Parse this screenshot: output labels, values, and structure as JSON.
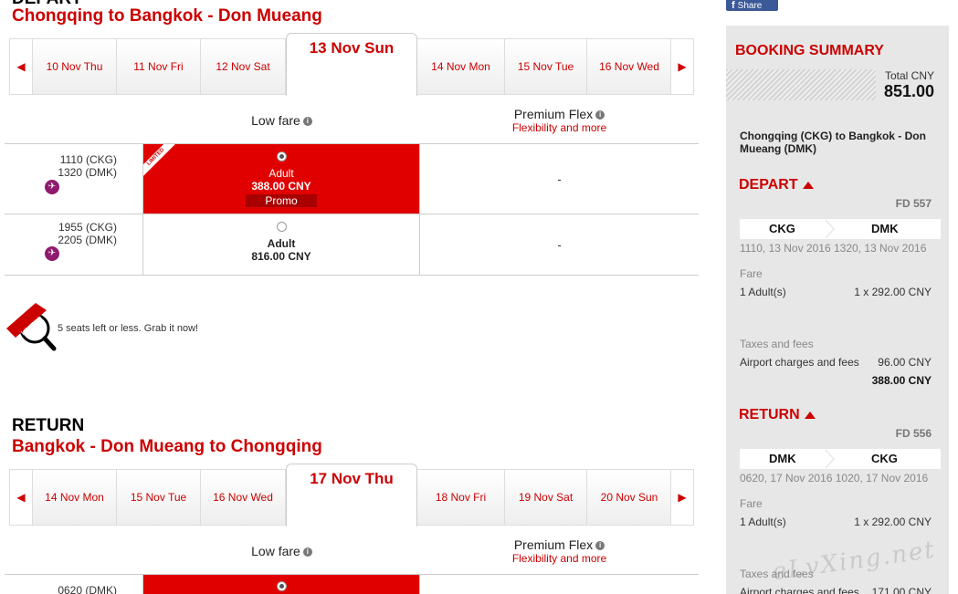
{
  "depart": {
    "label": "DEPART",
    "route": "Chongqing  to  Bangkok - Don Mueang",
    "days": [
      "10 Nov Thu",
      "11 Nov Fri",
      "12 Nov Sat",
      "13 Nov Sun",
      "14 Nov Mon",
      "15 Nov Tue",
      "16 Nov Wed"
    ],
    "fare_headers": {
      "low": "Low fare",
      "flex": "Premium Flex",
      "flex_sub": "Flexibility and more"
    },
    "flights": [
      {
        "dep": "1110  (CKG)",
        "arr": "1320  (DMK)",
        "pax": "Adult",
        "price": "388.00 CNY",
        "promo": "Promo",
        "ribbon": "LIMITED",
        "flex": "-"
      },
      {
        "dep": "1955  (CKG)",
        "arr": "2205  (DMK)",
        "pax": "Adult",
        "price": "816.00 CNY",
        "flex": "-"
      }
    ]
  },
  "limited": {
    "badge": "LIMITED",
    "note": "5 seats left or less. Grab it now!"
  },
  "return": {
    "label": "RETURN",
    "route": "Bangkok - Don Mueang  to  Chongqing",
    "days": [
      "14 Nov Mon",
      "15 Nov Tue",
      "16 Nov Wed",
      "17 Nov Thu",
      "18 Nov Fri",
      "19 Nov Sat",
      "20 Nov Sun"
    ],
    "fare_headers": {
      "low": "Low fare",
      "flex": "Premium Flex",
      "flex_sub": "Flexibility and more"
    },
    "flights": [
      {
        "dep": "0620  (DMK)"
      }
    ]
  },
  "share": {
    "icon": "f",
    "label": "Share"
  },
  "summary": {
    "title": "BOOKING SUMMARY",
    "total_label": "Total CNY",
    "total": "851.00",
    "route": "Chongqing (CKG) to Bangkok - Don Mueang (DMK)",
    "depart": {
      "label": "DEPART",
      "flight_no": "FD 557",
      "from": "CKG",
      "to": "DMK",
      "times": "1110, 13 Nov 2016 1320, 13 Nov 2016",
      "fare_label": "Fare",
      "adults": "1 Adult(s)",
      "fare_amount": "1 x 292.00 CNY",
      "taxes_label": "Taxes and fees",
      "airport_label": "Airport charges and fees",
      "airport_amount": "96.00 CNY",
      "subtotal": "388.00 CNY"
    },
    "return": {
      "label": "RETURN",
      "flight_no": "FD 556",
      "from": "DMK",
      "to": "CKG",
      "times": "0620, 17 Nov 2016 1020, 17 Nov 2016",
      "fare_label": "Fare",
      "adults": "1 Adult(s)",
      "fare_amount": "1 x 292.00 CNY",
      "taxes_label": "Taxes and fees",
      "airport_label": "Airport charges and fees",
      "airport_amount": "171.00 CNY"
    }
  },
  "watermark": "eLvXing.net",
  "colors": {
    "brand_red": "#cc0000",
    "promo_red": "#e10000",
    "facebook": "#3b5998",
    "plane_purple": "#8e1b6e"
  }
}
